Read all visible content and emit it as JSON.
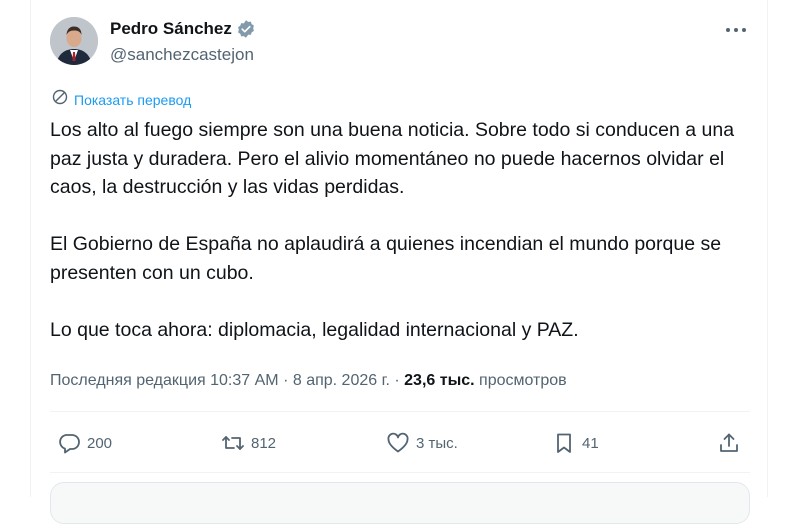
{
  "author": {
    "display_name": "Pedro Sánchez",
    "handle": "@sanchezcastejon"
  },
  "translate": {
    "label": "Показать перевод",
    "icon": "translate-icon"
  },
  "tweet": {
    "paragraphs": [
      "Los alto al fuego siempre son una buena noticia. Sobre todo si conducen a una paz justa y duradera. Pero el alivio momentáneo no puede hacernos olvidar el caos, la destrucción y las vidas perdidas.",
      "El Gobierno de España no aplaudirá a quienes incendian el mundo porque se presenten con un cubo.",
      "Lo que toca ahora: diplomacia, legalidad internacional y PAZ."
    ]
  },
  "meta": {
    "edited_label": "Последняя редакция",
    "time": "10:37 AM",
    "separator": "·",
    "date": "8 апр. 2026 г.",
    "views_count": "23,6 тыс.",
    "views_label": "просмотров"
  },
  "actions": {
    "replies": "200",
    "reposts": "812",
    "likes": "3 тыс.",
    "bookmarks": "41"
  },
  "colors": {
    "accent": "#1d9bf0",
    "text": "#0f1419",
    "muted": "#536471",
    "border": "#eff3f4"
  }
}
